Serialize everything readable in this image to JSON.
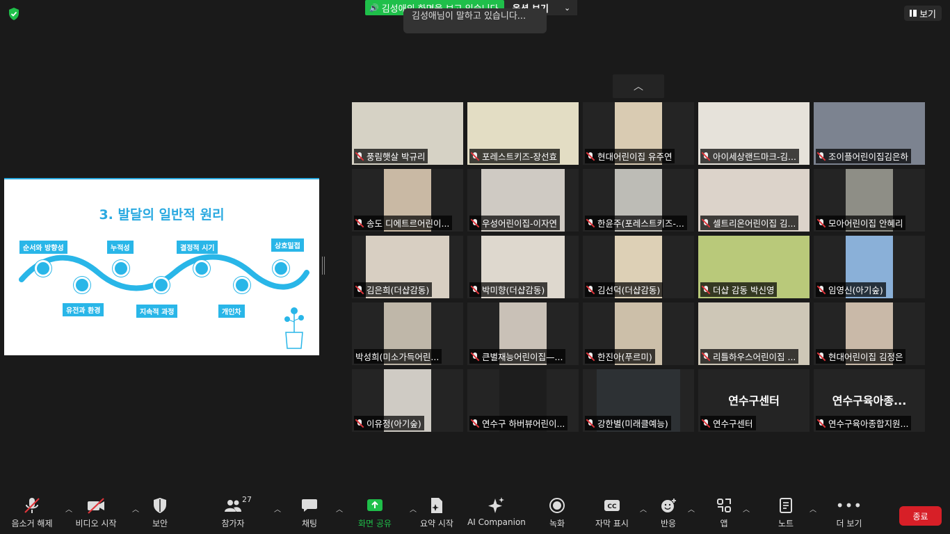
{
  "top": {
    "share_banner": "김성애의 화면을 보고 있습니다",
    "view_options": "옵션 보기",
    "speaking_toast": "김성애님이 말하고 있습니다...",
    "view_button": "보기"
  },
  "slide": {
    "title": "3. 발달의 일반적 원리",
    "labels_top": [
      "순서와 방향성",
      "누적성",
      "결정적 시기",
      "상호밀접"
    ],
    "labels_bottom": [
      "유전과 환경",
      "지속적 과정",
      "개인차"
    ]
  },
  "gallery": {
    "tiles": [
      {
        "name": "풍림햇살 박규리",
        "bg": "#c9cfc9",
        "video_bg": "#d6d2c5",
        "muted": true
      },
      {
        "name": "포레스트키즈-장선효",
        "bg": "#e7e1c8",
        "video_bg": "#e3ddc4",
        "muted": true
      },
      {
        "name": "현대어린이집 유주연",
        "bg": "#242424",
        "video_bg": "#d9cbb2",
        "muted": true
      },
      {
        "name": "아이세상랜드마크-김...",
        "bg": "#e9e6df",
        "video_bg": "#e6e2da",
        "muted": true
      },
      {
        "name": "조이플어린이집김은하",
        "bg": "#8d8f95",
        "video_bg": "#7c8390",
        "muted": true
      },
      {
        "name": "송도 디에트르어린이...",
        "bg": "#242424",
        "video_bg": "#c9b9a4",
        "muted": true
      },
      {
        "name": "우성어린이집-이자연",
        "bg": "#242424",
        "video_bg": "#cfcac3",
        "muted": true
      },
      {
        "name": "한윤주(포레스트키즈-...",
        "bg": "#242424",
        "video_bg": "#bdbcb6",
        "muted": true
      },
      {
        "name": "셀트리온어린이집 김...",
        "bg": "#e4ddd6",
        "video_bg": "#dcd3ca",
        "muted": true
      },
      {
        "name": "모아어린이집 안혜리",
        "bg": "#242424",
        "video_bg": "#8e8e86",
        "muted": true
      },
      {
        "name": "김은희(더샵감동)",
        "bg": "#242424",
        "video_bg": "#d8cfc2",
        "muted": true
      },
      {
        "name": "박미향(더샵감동)",
        "bg": "#e2dcd2",
        "video_bg": "#ded8ce",
        "muted": true
      },
      {
        "name": "김선덕(더샵감동)",
        "bg": "#242424",
        "video_bg": "#ddd0b6",
        "muted": true
      },
      {
        "name": "더샵 감동 박신영",
        "bg": "#a5c254",
        "video_bg": "#b9c97a",
        "muted": true
      },
      {
        "name": "임영신(아기숲)",
        "bg": "#242424",
        "video_bg": "#8ab0d8",
        "muted": true
      },
      {
        "name": "박성희(미소가득어린...",
        "bg": "#242424",
        "video_bg": "#bfb7a9",
        "muted": false
      },
      {
        "name": "큰별재능어린이집—...",
        "bg": "#242424",
        "video_bg": "#c9c1b7",
        "muted": true
      },
      {
        "name": "한진아(푸르미)",
        "bg": "#242424",
        "video_bg": "#ccbfa9",
        "muted": true
      },
      {
        "name": "리틀하우스어린이집 ...",
        "bg": "#d7d2c6",
        "video_bg": "#cec7b7",
        "muted": true
      },
      {
        "name": "현대어린이집 김정은",
        "bg": "#242424",
        "video_bg": "#c9b9a8",
        "muted": true
      },
      {
        "name": "이유정(아기숲)",
        "bg": "#242424",
        "video_bg": "#cfcbc4",
        "muted": true
      },
      {
        "name": "연수구 하버뷰어린이...",
        "bg": "#242424",
        "video_bg": "#1d1d1d",
        "muted": true
      },
      {
        "name": "강한별(미래클예능)",
        "bg": "#242424",
        "video_bg": "#2d3134",
        "muted": true
      },
      {
        "name": "연수구센터",
        "bg": "#242424",
        "video_bg": "",
        "muted": true,
        "big": "연수구센터"
      },
      {
        "name": "연수구육아종합지원...",
        "bg": "#242424",
        "video_bg": "",
        "muted": true,
        "big": "연수구육아종..."
      }
    ]
  },
  "toolbar": {
    "unmute": "음소거 해제",
    "video": "비디오 시작",
    "security": "보안",
    "participants": "참가자",
    "participants_count": "27",
    "chat": "채팅",
    "share": "화면 공유",
    "summary": "요약 시작",
    "ai": "AI Companion",
    "record": "녹화",
    "captions": "자막 표시",
    "reactions": "반응",
    "apps": "앱",
    "notes": "노트",
    "more": "더 보기",
    "end": "종료"
  },
  "colors": {
    "accent_green": "#1fbf4a",
    "end_red": "#d71f27",
    "slide_blue": "#29b6e8"
  }
}
